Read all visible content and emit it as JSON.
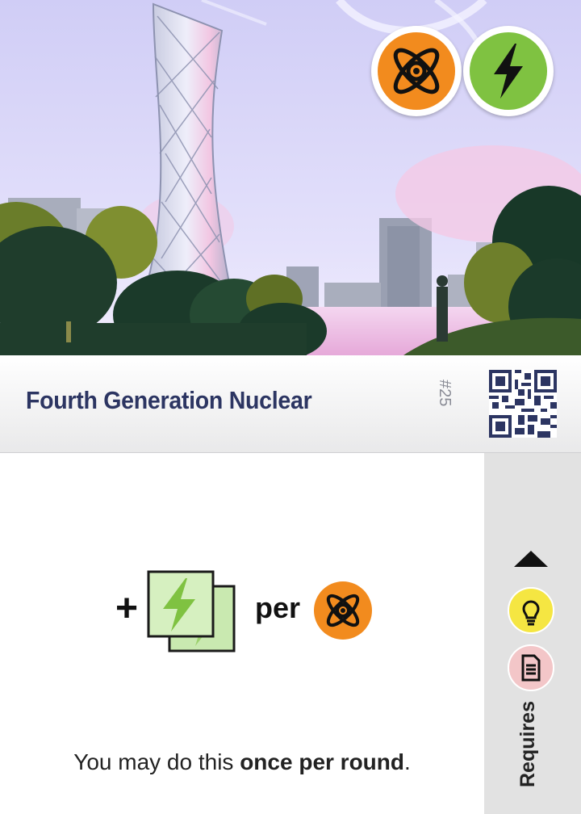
{
  "card": {
    "title": "Fourth Generation Nuclear",
    "number": "#25",
    "art_name": "nuclear-tower-cityscape",
    "top_icons": [
      {
        "name": "atom-icon",
        "color": "#f28b1e"
      },
      {
        "name": "lightning-icon",
        "color": "#7fc241"
      }
    ]
  },
  "effect": {
    "plus": "+",
    "gain_icon": "lightning-tile-stack",
    "per": "per",
    "per_icon": "atom-icon",
    "note_prefix": "You may do this ",
    "note_bold": "once per round",
    "note_suffix": "."
  },
  "requires": {
    "label": "Requires",
    "arrow": "up-triangle",
    "items": [
      {
        "name": "lightbulb-icon",
        "color": "#f5e642"
      },
      {
        "name": "document-icon",
        "color": "#f3c6c8"
      }
    ]
  },
  "colors": {
    "title": "#2c3562",
    "sky": "#dcd9f7",
    "atom_orange": "#f28b1e",
    "energy_green": "#7fc241",
    "tile_green": "#d6f0c0",
    "sidebar": "#e2e2e2"
  }
}
